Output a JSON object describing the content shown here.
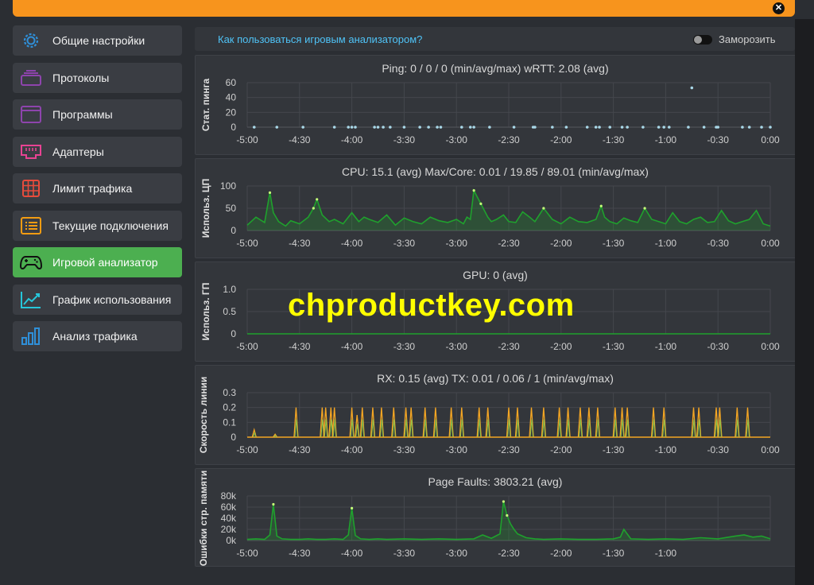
{
  "close_label": "✕",
  "sidebar": {
    "items": [
      {
        "label": "Общие настройки",
        "icon": "gear-icon",
        "color": "#2f8fd8"
      },
      {
        "label": "Протоколы",
        "icon": "protocols-icon",
        "color": "#8e44ad"
      },
      {
        "label": "Программы",
        "icon": "programs-icon",
        "color": "#8e44ad"
      },
      {
        "label": "Адаптеры",
        "icon": "ethernet-port-icon",
        "color": "#e84393"
      },
      {
        "label": "Лимит трафика",
        "icon": "table-grid-icon",
        "color": "#e74c3c"
      },
      {
        "label": "Текущие подключения",
        "icon": "list-icon",
        "color": "#f39c12"
      },
      {
        "label": "Игровой анализатор",
        "icon": "gamepad-icon",
        "color": "#111111",
        "active": true
      },
      {
        "label": "График использования",
        "icon": "line-chart-icon",
        "color": "#26c6da"
      },
      {
        "label": "Анализ трафика",
        "icon": "bar-chart-icon",
        "color": "#2f8fd8"
      }
    ]
  },
  "header": {
    "help_link": "Как пользоваться игровым анализатором?",
    "freeze_label": "Заморозить",
    "freeze_on": false
  },
  "x_ticks": [
    "-5:00",
    "-4:30",
    "-4:00",
    "-3:30",
    "-3:00",
    "-2:30",
    "-2:00",
    "-1:30",
    "-1:00",
    "-0:30",
    "0:00"
  ],
  "watermark": "chproductkey.com",
  "chart_data": [
    {
      "type": "scatter",
      "title": "Ping: 0 / 0 / 0 (min/avg/max)    wRTT: 2.08 (avg)",
      "ylabel": "Стат. пинга",
      "yticks": [
        "60",
        "40",
        "20",
        "0"
      ],
      "ylim": [
        0,
        60
      ],
      "xlim": [
        -300,
        0
      ],
      "x_unit": "seconds",
      "series": [
        {
          "color": "#a9d8e8",
          "x": [
            -296,
            -283,
            -268,
            -250,
            -242,
            -240,
            -238,
            -227,
            -225,
            -222,
            -218,
            -210,
            -201,
            -196,
            -191,
            -189,
            -177,
            -172,
            -170,
            -161,
            -147,
            -136,
            -135,
            -125,
            -117,
            -105,
            -100,
            -98,
            -92,
            -85,
            -82,
            -73,
            -64,
            -61,
            -58,
            -47,
            -45,
            -38,
            -31,
            -30,
            -16,
            -12,
            -5,
            0
          ],
          "y": [
            0,
            0,
            0,
            0,
            0,
            0,
            0,
            0,
            0,
            0,
            0,
            0,
            0,
            0,
            0,
            0,
            0,
            0,
            0,
            0,
            0,
            0,
            0,
            0,
            0,
            0,
            0,
            0,
            0,
            0,
            0,
            0,
            0,
            0,
            0,
            0,
            53,
            0,
            0,
            0,
            0,
            0,
            0,
            0
          ]
        }
      ]
    },
    {
      "type": "area",
      "title": "CPU: 15.1 (avg)    Max/Core: 0.01 / 19.85 / 89.01 (min/avg/max)",
      "ylabel": "Использ. ЦП",
      "yticks": [
        "100",
        "50",
        "0"
      ],
      "ylim": [
        0,
        100
      ],
      "xlim": [
        -300,
        0
      ],
      "x_unit": "seconds",
      "series": [
        {
          "color": "#1fa12d",
          "x": [
            -300,
            -295,
            -290,
            -287,
            -285,
            -282,
            -278,
            -275,
            -270,
            -265,
            -262,
            -260,
            -257,
            -253,
            -250,
            -245,
            -240,
            -236,
            -233,
            -230,
            -225,
            -220,
            -215,
            -210,
            -205,
            -200,
            -195,
            -190,
            -185,
            -180,
            -176,
            -174,
            -172,
            -170,
            -166,
            -162,
            -160,
            -157,
            -153,
            -150,
            -146,
            -142,
            -138,
            -135,
            -130,
            -125,
            -120,
            -115,
            -110,
            -105,
            -100,
            -97,
            -95,
            -92,
            -88,
            -84,
            -80,
            -76,
            -72,
            -68,
            -64,
            -60,
            -56,
            -52,
            -48,
            -44,
            -40,
            -36,
            -32,
            -28,
            -24,
            -20,
            -16,
            -12,
            -8,
            -4,
            0
          ],
          "y": [
            12,
            30,
            18,
            85,
            40,
            20,
            10,
            22,
            15,
            30,
            50,
            70,
            35,
            20,
            25,
            15,
            40,
            20,
            30,
            25,
            18,
            35,
            12,
            28,
            20,
            15,
            30,
            22,
            18,
            25,
            15,
            30,
            25,
            90,
            60,
            30,
            20,
            25,
            35,
            20,
            18,
            42,
            30,
            20,
            50,
            25,
            15,
            30,
            20,
            18,
            25,
            55,
            30,
            20,
            15,
            28,
            22,
            18,
            50,
            25,
            20,
            15,
            40,
            20,
            15,
            25,
            30,
            18,
            20,
            45,
            22,
            15,
            20,
            25,
            45,
            15,
            10
          ]
        }
      ]
    },
    {
      "type": "line",
      "title": "GPU: 0 (avg)",
      "ylabel": "Использ. ГП",
      "yticks": [
        "1.0",
        "0.5",
        "0"
      ],
      "ylim": [
        0,
        1
      ],
      "xlim": [
        -300,
        0
      ],
      "x_unit": "seconds",
      "series": [
        {
          "color": "#1fa12d",
          "x": [
            -300,
            0
          ],
          "y": [
            0,
            0
          ]
        }
      ]
    },
    {
      "type": "line",
      "title": "RX: 0.15 (avg)    TX: 0.01 / 0.06 / 1 (min/avg/max)",
      "ylabel": "Скорость линии",
      "yticks": [
        "0.3",
        "0.2",
        "0.1",
        "0"
      ],
      "ylim": [
        0,
        0.3
      ],
      "xlim": [
        -300,
        0
      ],
      "x_unit": "seconds",
      "spikes": {
        "rx_color": "#8bc34a",
        "tx_color": "#f5a623",
        "x": [
          -296,
          -284,
          -272,
          -257,
          -255,
          -252,
          -250,
          -240,
          -237,
          -234,
          -228,
          -223,
          -216,
          -209,
          -206,
          -198,
          -192,
          -183,
          -177,
          -167,
          -162,
          -150,
          -145,
          -137,
          -130,
          -121,
          -116,
          -109,
          -104,
          -99,
          -89,
          -85,
          -82,
          -67,
          -61,
          -44,
          -41,
          -31,
          -29,
          -19,
          -13
        ],
        "y": [
          0.05,
          0.02,
          0.2,
          0.2,
          0.2,
          0.2,
          0.2,
          0.2,
          0.15,
          0.2,
          0.2,
          0.2,
          0.2,
          0.2,
          0.2,
          0.2,
          0.2,
          0.2,
          0.2,
          0.2,
          0.2,
          0.2,
          0.2,
          0.2,
          0.2,
          0.2,
          0.2,
          0.2,
          0.2,
          0.2,
          0.2,
          0.2,
          0.2,
          0.2,
          0.2,
          0.2,
          0.2,
          0.2,
          0.2,
          0.2,
          0.2
        ]
      }
    },
    {
      "type": "area",
      "title": "Page Faults: 3803.21 (avg)",
      "ylabel": "Ошибки стр. памяти",
      "yticks": [
        "80k",
        "60k",
        "40k",
        "20k",
        "0k"
      ],
      "ylim": [
        0,
        80000
      ],
      "xlim": [
        -300,
        0
      ],
      "x_unit": "seconds",
      "series": [
        {
          "color": "#1fa12d",
          "x": [
            -300,
            -295,
            -290,
            -287,
            -285,
            -283,
            -280,
            -275,
            -270,
            -265,
            -260,
            -255,
            -250,
            -245,
            -242,
            -240,
            -238,
            -235,
            -230,
            -225,
            -220,
            -210,
            -200,
            -190,
            -180,
            -170,
            -165,
            -160,
            -155,
            -153,
            -151,
            -149,
            -147,
            -145,
            -140,
            -135,
            -130,
            -120,
            -110,
            -100,
            -90,
            -86,
            -84,
            -80,
            -70,
            -60,
            -50,
            -40,
            -30,
            -20,
            -15,
            -10,
            -5,
            0
          ],
          "y": [
            2000,
            3000,
            2000,
            10000,
            65000,
            8000,
            3000,
            2000,
            2000,
            3000,
            2000,
            2000,
            3000,
            2000,
            10000,
            58000,
            9000,
            3000,
            2000,
            3000,
            2000,
            3000,
            2000,
            3000,
            2000,
            3000,
            10000,
            4000,
            12000,
            70000,
            45000,
            30000,
            20000,
            12000,
            5000,
            3000,
            2000,
            3000,
            2000,
            2000,
            3000,
            6000,
            20000,
            3000,
            2000,
            3000,
            2000,
            5000,
            3000,
            8000,
            10000,
            6000,
            8000,
            3000
          ]
        }
      ]
    }
  ]
}
